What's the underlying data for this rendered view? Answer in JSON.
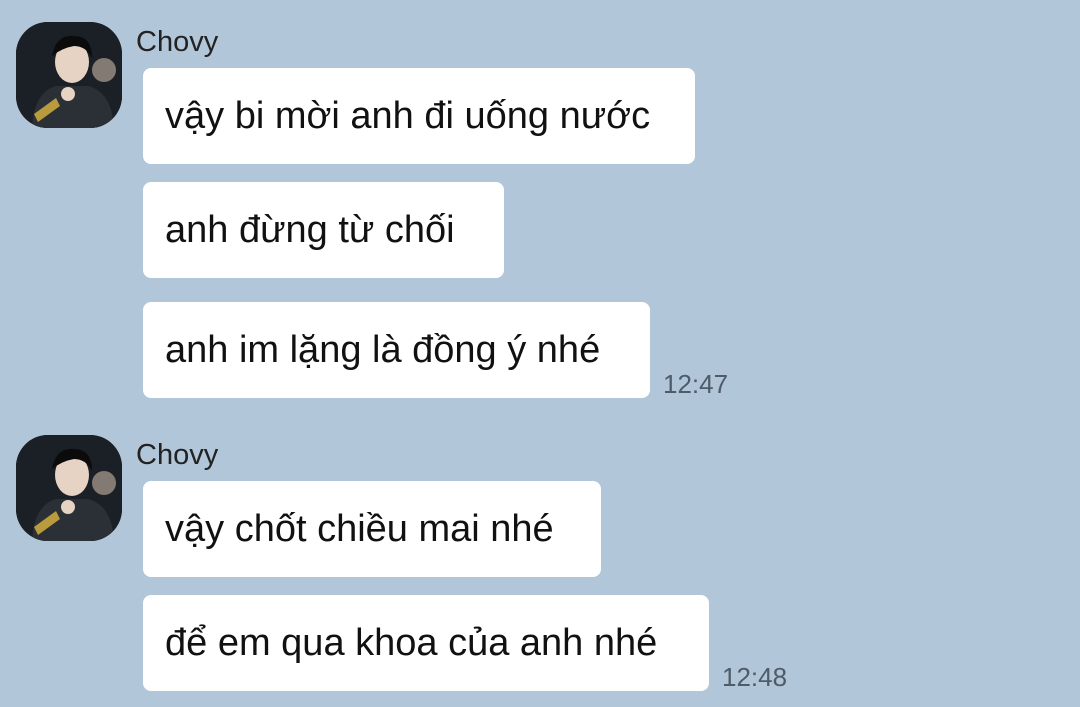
{
  "groups": [
    {
      "sender": "Chovy",
      "avatar_icon": "profile-photo",
      "messages": [
        "vậy bi mời anh đi uống nước",
        "anh đừng từ chối",
        "anh im lặng là đồng ý nhé"
      ],
      "time": "12:47"
    },
    {
      "sender": "Chovy",
      "avatar_icon": "profile-photo",
      "messages": [
        "vậy chốt chiều mai nhé",
        "để em qua khoa của anh nhé"
      ],
      "time": "12:48"
    }
  ],
  "colors": {
    "background": "#b2c6d9",
    "bubble": "#ffffff",
    "timestamp": "#4e5b68"
  }
}
